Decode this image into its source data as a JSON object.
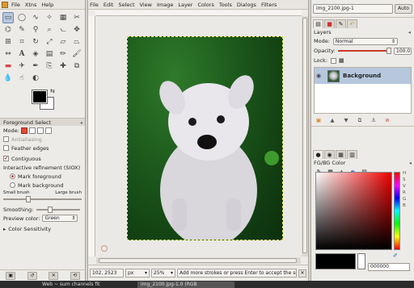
{
  "toolbox": {
    "menu": [
      "File",
      "Xtns",
      "Help"
    ],
    "tool_icons": [
      "rect-select-icon",
      "ellipse-select-icon",
      "free-select-icon",
      "fuzzy-select-icon",
      "select-by-color-icon",
      "scissors-icon",
      "foreground-select-icon",
      "paths-icon",
      "color-picker-icon",
      "zoom-icon",
      "measure-icon",
      "move-icon",
      "align-icon",
      "crop-icon",
      "rotate-icon",
      "scale-icon",
      "shear-icon",
      "perspective-icon",
      "flip-icon",
      "text-icon",
      "bucket-fill-icon",
      "blend-icon",
      "pencil-icon",
      "paintbrush-icon",
      "eraser-icon",
      "airbrush-icon",
      "ink-icon",
      "clone-icon",
      "heal-icon",
      "perspective-clone-icon",
      "blur-icon",
      "smudge-icon",
      "dodge-burn-icon"
    ],
    "options": {
      "title": "Foreground Select",
      "mode_label": "Mode:",
      "antialiasing": "Antialiasing",
      "feather_edges": "Feather edges",
      "contiguous": "Contiguous",
      "interactive_refinement": "Interactive refinement (SIOX)",
      "mark_foreground": "Mark foreground",
      "mark_background": "Mark background",
      "small_brush": "Small brush",
      "large_brush": "Large brush",
      "smoothing": "Smoothing:",
      "preview_color_label": "Preview color:",
      "preview_color": "Green",
      "color_sensitivity": "Color Sensitivity"
    }
  },
  "image_window": {
    "menu": [
      "File",
      "Edit",
      "Select",
      "View",
      "Image",
      "Layer",
      "Colors",
      "Tools",
      "Dialogs",
      "Filters"
    ],
    "status": {
      "coords": "102, 2523",
      "unit": "px",
      "zoom": "25%",
      "message": "Add more strokes or press Enter to accept the selection"
    }
  },
  "dock": {
    "image_select": "img_2100.jpg-1",
    "auto_label": "Auto",
    "layers": {
      "title": "Layers",
      "mode_label": "Mode:",
      "mode_value": "Normal",
      "opacity_label": "Opacity:",
      "opacity_value": "100.0",
      "lock_label": "Lock:",
      "layer_name": "Background"
    },
    "fgbg": {
      "title": "FG/BG Color",
      "hex_value": "000000",
      "scale_letters": [
        "H",
        "S",
        "V",
        "R",
        "G",
        "B"
      ]
    }
  },
  "taskbar": {
    "tasks": [
      "Web ~ sum channels fit",
      "img_2100.jpg-1.0 (RGB"
    ]
  },
  "colors": {
    "selection_highlight": "#b6c7de",
    "preview_green": "#1d5a1c",
    "fg_color": "#000000",
    "bg_color": "#ffffff"
  }
}
